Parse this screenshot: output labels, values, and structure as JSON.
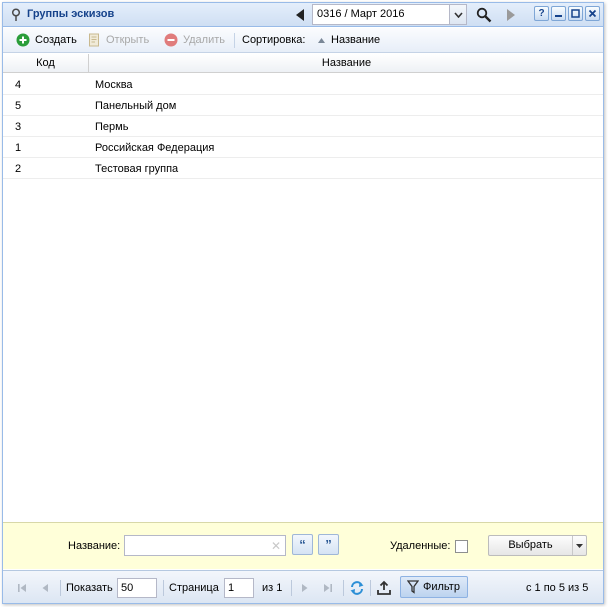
{
  "window": {
    "title": "Группы эскизов"
  },
  "period": {
    "value": "0316 / Март 2016"
  },
  "title_buttons": {
    "help": "?"
  },
  "toolbar": {
    "create": "Создать",
    "open": "Открыть",
    "delete": "Удалить",
    "sort_label": "Сортировка:",
    "sort_field": "Название"
  },
  "grid": {
    "columns": [
      "Код",
      "Название"
    ],
    "rows": [
      {
        "code": "4",
        "name": "Москва"
      },
      {
        "code": "5",
        "name": "Панельный дом"
      },
      {
        "code": "3",
        "name": "Пермь"
      },
      {
        "code": "1",
        "name": "Российская Федерация"
      },
      {
        "code": "2",
        "name": "Тестовая группа"
      }
    ]
  },
  "filter": {
    "name_label": "Название:",
    "name_value": "",
    "deleted_label": "Удаленные:",
    "select_button": "Выбрать"
  },
  "paging": {
    "show_label": "Показать",
    "page_size": "50",
    "page_label": "Страница",
    "page": "1",
    "of_total": "из 1",
    "filter_button": "Фильтр",
    "summary": "с 1 по 5 из 5"
  },
  "colors": {
    "accent": "#15428b",
    "filter_panel": "#ffffd9",
    "create_icon": "#2a9d3a",
    "delete_icon": "#e07c7c"
  }
}
